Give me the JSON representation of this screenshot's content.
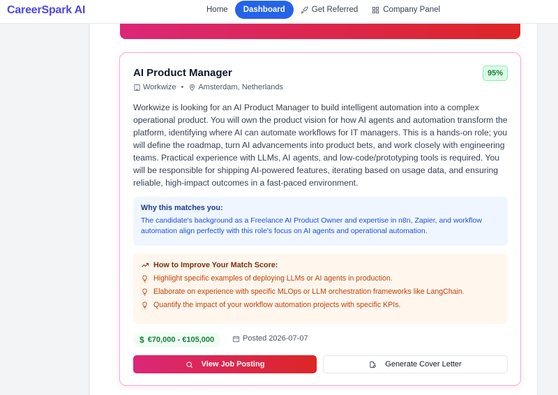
{
  "app": {
    "brand": "CareerSpark AI",
    "accent": "#2563eb",
    "brand_color": "#4f46e5"
  },
  "nav": {
    "home": "Home",
    "dashboard": "Dashboard",
    "referred": "Get Referred",
    "company": "Company Panel"
  },
  "job": {
    "title": "AI Product Manager",
    "match_score": "95%",
    "company": "Workwize",
    "location": "Amsterdam, Netherlands",
    "description": "Workwize is looking for an AI Product Manager to build intelligent automation into a complex operational product. You will own the product vision for how AI agents and automation transform the platform, identifying where AI can automate workflows for IT managers. This is a hands-on role; you will define the roadmap, turn AI advancements into product bets, and work closely with engineering teams. Practical experience with LLMs, AI agents, and low-code/prototyping tools is required. You will be responsible for shipping AI-powered features, iterating based on usage data, and ensuring reliable, high-impact outcomes in a fast-paced environment.",
    "why_title": "Why this matches you:",
    "why_text": "The candidate's background as a Freelance AI Product Owner and expertise in n8n, Zapier, and workflow automation align perfectly with this role's focus on AI agents and operational automation.",
    "improve_title": "How to Improve Your Match Score:",
    "tips": [
      "Highlight specific examples of deploying LLMs or AI agents in production.",
      "Elaborate on experience with specific MLOps or LLM orchestration frameworks like LangChain.",
      "Quantify the impact of your workflow automation projects with specific KPIs."
    ],
    "salary_symbol": "$",
    "salary": "€70,000 - €105,000",
    "posted": "Posted 2026-07-07",
    "view_button": "View Job Posting",
    "cover_button": "Generate Cover Letter"
  }
}
